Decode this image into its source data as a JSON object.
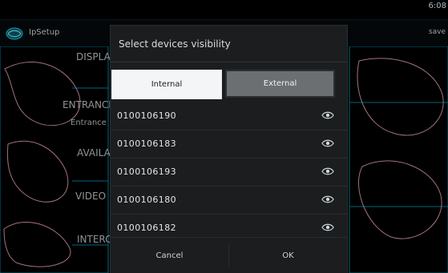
{
  "status": {
    "text": "6:08"
  },
  "app": {
    "title": "IpSetup",
    "right_text": "save"
  },
  "background_labels": {
    "l1": "DISPLAY",
    "l2": "ENTRANCE",
    "l3": "Entrance",
    "l4": "AVAILABLE",
    "l5": "VIDEO",
    "l6": "INTERCOM"
  },
  "dialog": {
    "title": "Select devices visibility",
    "tabs": {
      "internal": "Internal",
      "external": "External"
    },
    "devices": [
      {
        "id": "0100106190"
      },
      {
        "id": "0100106183"
      },
      {
        "id": "0100106193"
      },
      {
        "id": "0100106180"
      },
      {
        "id": "0100106182"
      }
    ],
    "buttons": {
      "cancel": "Cancel",
      "ok": "OK"
    }
  },
  "icons": {
    "app": "app-globe-icon",
    "visibility": "eye-icon"
  },
  "colors": {
    "accent": "#00d7ff",
    "dialog_bg": "#1b1d1f"
  }
}
